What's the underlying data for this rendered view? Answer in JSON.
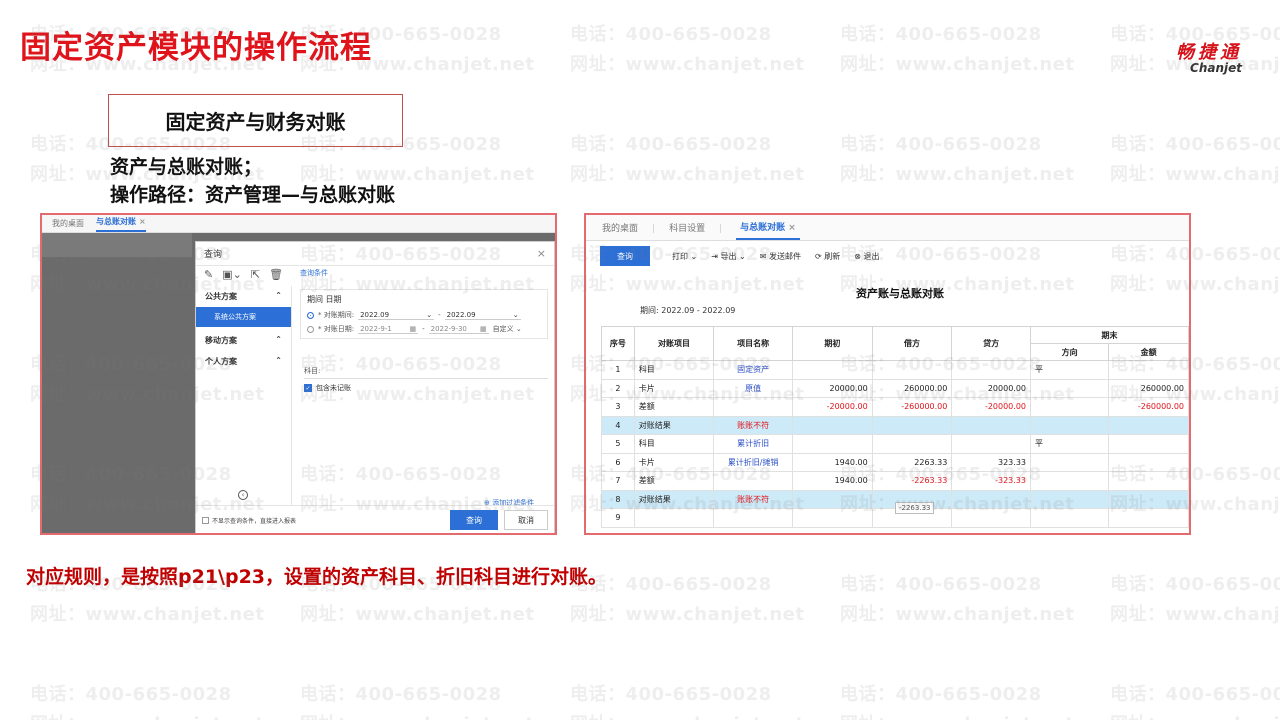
{
  "slide": {
    "title": "固定资产模块的操作流程",
    "subtitle_box": "固定资产与财务对账",
    "desc_line1": "资产与总账对账；",
    "desc_line2": "操作路径：资产管理—与总账对账",
    "rule_text": "对应规则，是按照p21\\p23，设置的资产科目、折旧科目进行对账。"
  },
  "logo": {
    "cn": "畅捷通",
    "en": "Chanjet"
  },
  "watermark": {
    "phone": "电话：400-665-0028",
    "site": "网址：www.chanjet.net"
  },
  "left_screen": {
    "tabs": [
      "我的桌面",
      "与总账对账"
    ],
    "tab_close": "×",
    "dialog": {
      "title": "查询",
      "close": "×",
      "tools": [
        "✎",
        "▣⌄",
        "⇱",
        "🗑"
      ],
      "schemes": {
        "public": "公共方案",
        "public_item": "系统公共方案",
        "mobile": "移动方案",
        "personal": "个人方案"
      },
      "query_conditions_link": "查询条件",
      "period_title": "期间 日期",
      "period_label": "* 对账期间:",
      "period_from": "2022.09",
      "period_to": "2022.09",
      "date_label": "* 对账日期:",
      "date_from": "2022-9-1",
      "date_to": "2022-9-30",
      "custom": "自定义",
      "subject_label": "科目:",
      "include_unposted": "包含未记账",
      "add_filter": "添加过滤条件",
      "footer_note": "不显示查询条件，直接进入报表",
      "btn_query": "查询",
      "btn_cancel": "取消"
    }
  },
  "right_screen": {
    "tabs": [
      "我的桌面",
      "科目设置",
      "与总账对账"
    ],
    "tab_close": "×",
    "toolbar": {
      "query": "查询",
      "print": "打印",
      "export": "导出",
      "email": "发送邮件",
      "refresh": "刷新",
      "exit": "退出"
    },
    "report_title": "资产账与总账对账",
    "period": "期间:  2022.09 - 2022.09",
    "tooltip": "-2263.33",
    "headers": {
      "seq": "序号",
      "item": "对账项目",
      "name": "项目名称",
      "opening": "期初",
      "debit": "借方",
      "credit": "贷方",
      "closing": "期末",
      "direction": "方向",
      "amount": "金额"
    },
    "rows": [
      {
        "seq": "1",
        "item": "科目",
        "name": "固定资产",
        "opening": "",
        "debit": "",
        "credit": "",
        "direction": "平",
        "amount": "",
        "hl": false,
        "neg": false,
        "name_color": "blue"
      },
      {
        "seq": "2",
        "item": "卡片",
        "name": "原值",
        "opening": "20000.00",
        "debit": "260000.00",
        "credit": "20000.00",
        "direction": "",
        "amount": "260000.00",
        "hl": false,
        "neg": false,
        "name_color": "blue"
      },
      {
        "seq": "3",
        "item": "差额",
        "name": "",
        "opening": "-20000.00",
        "debit": "-260000.00",
        "credit": "-20000.00",
        "direction": "",
        "amount": "-260000.00",
        "hl": false,
        "neg": true,
        "name_color": ""
      },
      {
        "seq": "4",
        "item": "对账结果",
        "name": "账账不符",
        "opening": "",
        "debit": "",
        "credit": "",
        "direction": "",
        "amount": "",
        "hl": true,
        "neg": false,
        "name_color": "red"
      },
      {
        "seq": "5",
        "item": "科目",
        "name": "累计折旧",
        "opening": "",
        "debit": "",
        "credit": "",
        "direction": "平",
        "amount": "",
        "hl": false,
        "neg": false,
        "name_color": "blue"
      },
      {
        "seq": "6",
        "item": "卡片",
        "name": "累计折旧/摊销",
        "opening": "1940.00",
        "debit": "2263.33",
        "credit": "323.33",
        "direction": "",
        "amount": "",
        "hl": false,
        "neg": false,
        "name_color": "blue"
      },
      {
        "seq": "7",
        "item": "差额",
        "name": "",
        "opening": "1940.00",
        "debit": "-2263.33",
        "credit": "-323.33",
        "direction": "",
        "amount": "",
        "hl": false,
        "neg": true,
        "name_color": ""
      },
      {
        "seq": "8",
        "item": "对账结果",
        "name": "账账不符",
        "opening": "",
        "debit": "",
        "credit": "",
        "direction": "",
        "amount": "",
        "hl": true,
        "neg": false,
        "name_color": "red"
      },
      {
        "seq": "9",
        "item": "",
        "name": "",
        "opening": "",
        "debit": "",
        "credit": "",
        "direction": "",
        "amount": "",
        "hl": false,
        "neg": false,
        "name_color": ""
      }
    ]
  }
}
